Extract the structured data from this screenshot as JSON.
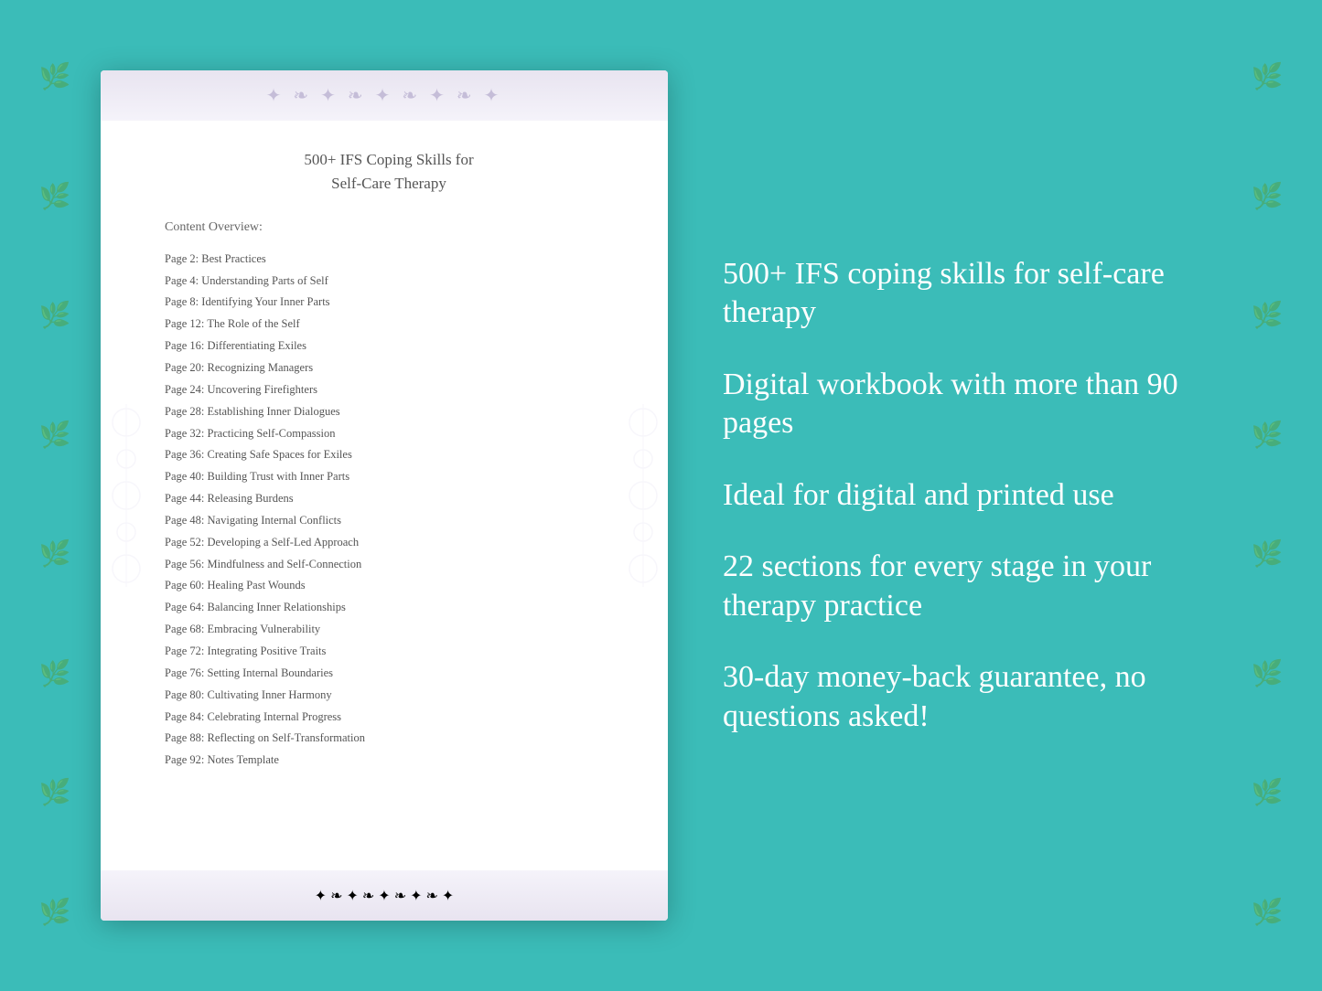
{
  "background_color": "#3bbcb8",
  "page_document": {
    "title_line1": "500+ IFS Coping Skills for",
    "title_line2": "Self-Care Therapy",
    "toc_header": "Content Overview:",
    "toc_items": [
      {
        "page": "Page  2:",
        "title": "Best Practices"
      },
      {
        "page": "Page  4:",
        "title": "Understanding Parts of Self"
      },
      {
        "page": "Page  8:",
        "title": "Identifying Your Inner Parts"
      },
      {
        "page": "Page 12:",
        "title": "The Role of the Self"
      },
      {
        "page": "Page 16:",
        "title": "Differentiating Exiles"
      },
      {
        "page": "Page 20:",
        "title": "Recognizing Managers"
      },
      {
        "page": "Page 24:",
        "title": "Uncovering Firefighters"
      },
      {
        "page": "Page 28:",
        "title": "Establishing Inner Dialogues"
      },
      {
        "page": "Page 32:",
        "title": "Practicing Self-Compassion"
      },
      {
        "page": "Page 36:",
        "title": "Creating Safe Spaces for Exiles"
      },
      {
        "page": "Page 40:",
        "title": "Building Trust with Inner Parts"
      },
      {
        "page": "Page 44:",
        "title": "Releasing Burdens"
      },
      {
        "page": "Page 48:",
        "title": "Navigating Internal Conflicts"
      },
      {
        "page": "Page 52:",
        "title": "Developing a Self-Led Approach"
      },
      {
        "page": "Page 56:",
        "title": "Mindfulness and Self-Connection"
      },
      {
        "page": "Page 60:",
        "title": "Healing Past Wounds"
      },
      {
        "page": "Page 64:",
        "title": "Balancing Inner Relationships"
      },
      {
        "page": "Page 68:",
        "title": "Embracing Vulnerability"
      },
      {
        "page": "Page 72:",
        "title": "Integrating Positive Traits"
      },
      {
        "page": "Page 76:",
        "title": "Setting Internal Boundaries"
      },
      {
        "page": "Page 80:",
        "title": "Cultivating Inner Harmony"
      },
      {
        "page": "Page 84:",
        "title": "Celebrating Internal Progress"
      },
      {
        "page": "Page 88:",
        "title": "Reflecting on Self-Transformation"
      },
      {
        "page": "Page 92:",
        "title": "Notes Template"
      }
    ]
  },
  "features": [
    {
      "id": "feature-1",
      "text": "500+ IFS coping skills for self-care therapy"
    },
    {
      "id": "feature-2",
      "text": "Digital workbook with more than 90 pages"
    },
    {
      "id": "feature-3",
      "text": "Ideal for digital and printed use"
    },
    {
      "id": "feature-4",
      "text": "22 sections for every stage in your therapy practice"
    },
    {
      "id": "feature-5",
      "text": "30-day money-back guarantee, no questions asked!"
    }
  ],
  "floral_icon": "❧",
  "deco_icon": "✿"
}
